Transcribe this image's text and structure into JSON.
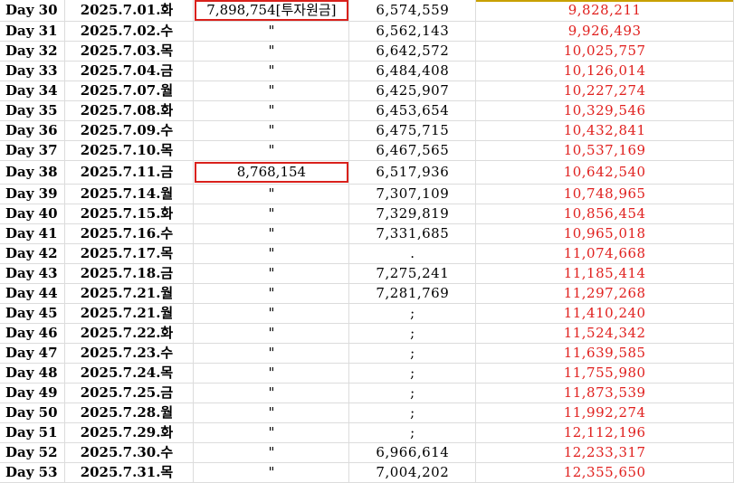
{
  "colors": {
    "cumulative_text": "#e0201e",
    "highlight_box": "#d9211c",
    "grid": "#dcdcdc"
  },
  "rows": [
    {
      "day": "Day 30",
      "date": "2025.7.01.화",
      "invest": "7,898,754[투자원금]",
      "value": "6,574,559",
      "cum": "9,828,211",
      "boxed": true
    },
    {
      "day": "Day 31",
      "date": "2025.7.02.수",
      "invest": "\"",
      "value": "6,562,143",
      "cum": "9,926,493",
      "boxed": false
    },
    {
      "day": "Day 32",
      "date": "2025.7.03.목",
      "invest": "\"",
      "value": "6,642,572",
      "cum": "10,025,757",
      "boxed": false
    },
    {
      "day": "Day 33",
      "date": "2025.7.04.금",
      "invest": "\"",
      "value": "6,484,408",
      "cum": "10,126,014",
      "boxed": false
    },
    {
      "day": "Day 34",
      "date": "2025.7.07.월",
      "invest": "\"",
      "value": "6,425,907",
      "cum": "10,227,274",
      "boxed": false
    },
    {
      "day": "Day 35",
      "date": "2025.7.08.화",
      "invest": "\"",
      "value": "6,453,654",
      "cum": "10,329,546",
      "boxed": false
    },
    {
      "day": "Day 36",
      "date": "2025.7.09.수",
      "invest": "\"",
      "value": "6,475,715",
      "cum": "10,432,841",
      "boxed": false
    },
    {
      "day": "Day 37",
      "date": "2025.7.10.목",
      "invest": "\"",
      "value": "6,467,565",
      "cum": "10,537,169",
      "boxed": false
    },
    {
      "day": "Day 38",
      "date": "2025.7.11.금",
      "invest": "8,768,154",
      "value": "6,517,936",
      "cum": "10,642,540",
      "boxed": true
    },
    {
      "day": "Day 39",
      "date": "2025.7.14.월",
      "invest": "\"",
      "value": "7,307,109",
      "cum": "10,748,965",
      "boxed": false
    },
    {
      "day": "Day 40",
      "date": "2025.7.15.화",
      "invest": "\"",
      "value": "7,329,819",
      "cum": "10,856,454",
      "boxed": false
    },
    {
      "day": "Day 41",
      "date": "2025.7.16.수",
      "invest": "\"",
      "value": "7,331,685",
      "cum": "10,965,018",
      "boxed": false
    },
    {
      "day": "Day 42",
      "date": "2025.7.17.목",
      "invest": "\"",
      "value": ".",
      "cum": "11,074,668",
      "boxed": false
    },
    {
      "day": "Day 43",
      "date": "2025.7.18.금",
      "invest": "\"",
      "value": "7,275,241",
      "cum": "11,185,414",
      "boxed": false
    },
    {
      "day": "Day 44",
      "date": "2025.7.21.월",
      "invest": "\"",
      "value": "7,281,769",
      "cum": "11,297,268",
      "boxed": false
    },
    {
      "day": "Day 45",
      "date": "2025.7.21.월",
      "invest": "\"",
      "value": ";",
      "cum": "11,410,240",
      "boxed": false
    },
    {
      "day": "Day 46",
      "date": "2025.7.22.화",
      "invest": "\"",
      "value": ";",
      "cum": "11,524,342",
      "boxed": false
    },
    {
      "day": "Day 47",
      "date": "2025.7.23.수",
      "invest": "\"",
      "value": ";",
      "cum": "11,639,585",
      "boxed": false
    },
    {
      "day": "Day 48",
      "date": "2025.7.24.목",
      "invest": "\"",
      "value": ";",
      "cum": "11,755,980",
      "boxed": false
    },
    {
      "day": "Day 49",
      "date": "2025.7.25.금",
      "invest": "\"",
      "value": ";",
      "cum": "11,873,539",
      "boxed": false
    },
    {
      "day": "Day 50",
      "date": "2025.7.28.월",
      "invest": "\"",
      "value": ";",
      "cum": "11,992,274",
      "boxed": false
    },
    {
      "day": "Day 51",
      "date": "2025.7.29.화",
      "invest": "\"",
      "value": ";",
      "cum": "12,112,196",
      "boxed": false
    },
    {
      "day": "Day 52",
      "date": "2025.7.30.수",
      "invest": "\"",
      "value": "6,966,614",
      "cum": "12,233,317",
      "boxed": false
    },
    {
      "day": "Day 53",
      "date": "2025.7.31.목",
      "invest": "\"",
      "value": "7,004,202",
      "cum": "12,355,650",
      "boxed": false
    }
  ]
}
